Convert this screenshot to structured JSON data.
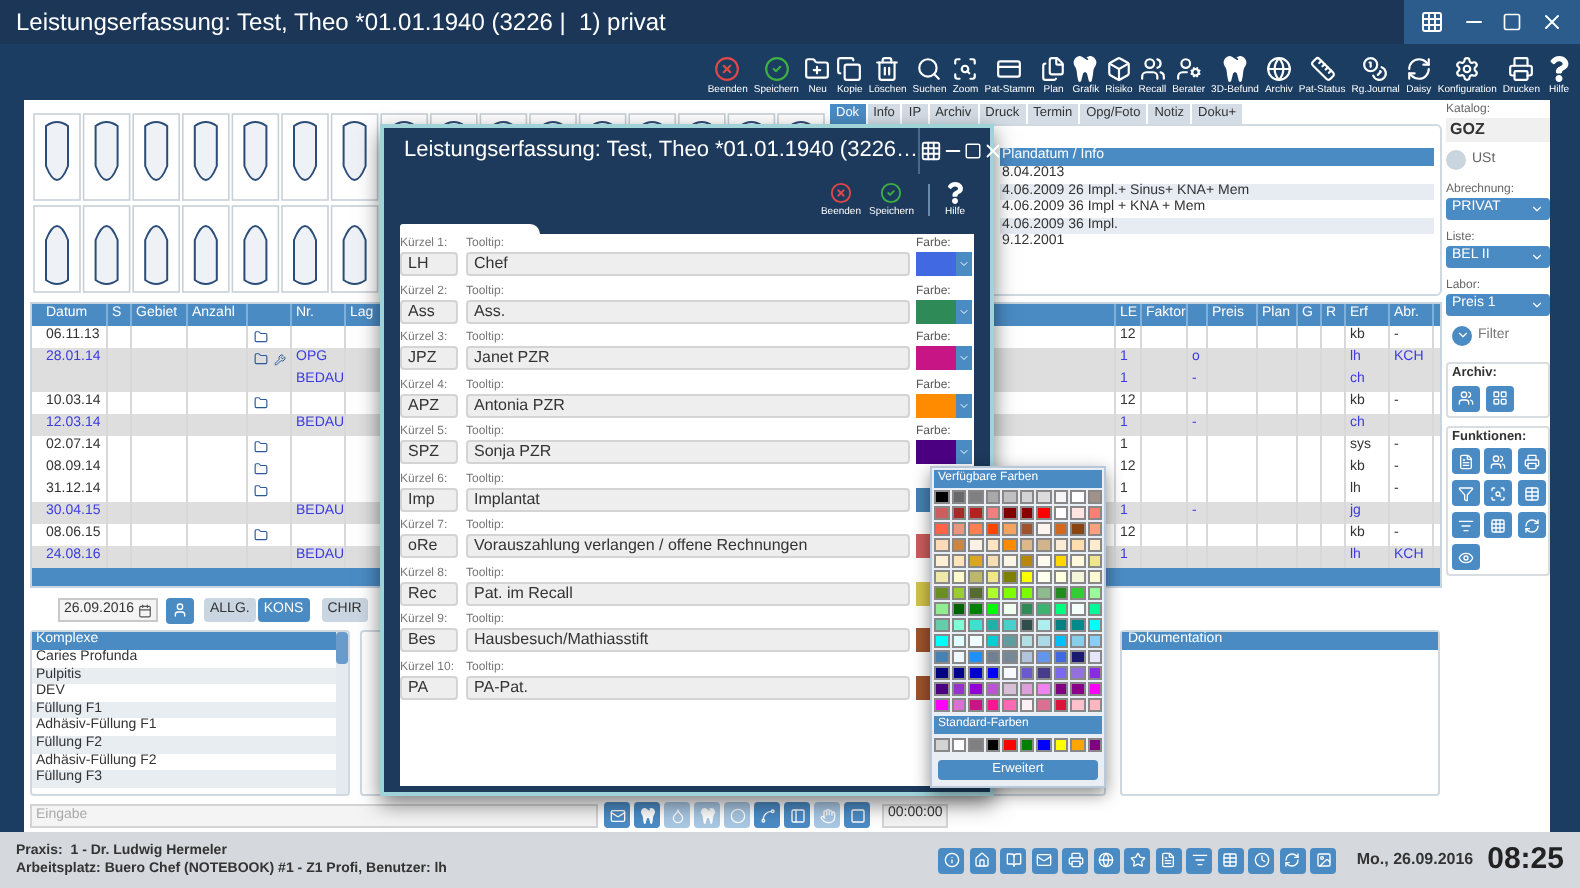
{
  "window": {
    "title": "Leistungserfassung: Test, Theo *01.01.1940 (3226 |  1) privat"
  },
  "toolbar": [
    {
      "label": "Beenden"
    },
    {
      "label": "Speichern"
    },
    {
      "label": "Neu"
    },
    {
      "label": "Kopie"
    },
    {
      "label": "Löschen"
    },
    {
      "label": "Suchen"
    },
    {
      "label": "Zoom"
    },
    {
      "label": "Pat-Stamm"
    },
    {
      "label": "Plan"
    },
    {
      "label": "Grafik"
    },
    {
      "label": "Risiko"
    },
    {
      "label": "Recall"
    },
    {
      "label": "Berater"
    },
    {
      "label": "3D-Befund"
    },
    {
      "label": "Archiv"
    },
    {
      "label": "Pat-Status"
    },
    {
      "label": "Rg.Journal"
    },
    {
      "label": "Daisy"
    },
    {
      "label": "Konfiguration"
    },
    {
      "label": "Drucken"
    },
    {
      "label": "Hilfe"
    }
  ],
  "tabs": [
    {
      "label": "Dok",
      "selected": true
    },
    {
      "label": "Info",
      "selected": false
    },
    {
      "label": "IP",
      "selected": false
    },
    {
      "label": "Archiv",
      "selected": false
    },
    {
      "label": "Druck",
      "selected": false
    },
    {
      "label": "Termin",
      "selected": false
    },
    {
      "label": "Opg/Foto",
      "selected": false
    },
    {
      "label": "Notiz",
      "selected": false
    },
    {
      "label": "Doku+",
      "selected": false
    }
  ],
  "info_panel": {
    "header": "Plandatum / Info",
    "rows": [
      "8.04.2013",
      "4.06.2009 26 Impl.+ Sinus+ KNA+ Mem",
      "4.06.2009 36 Impl + KNA + Mem",
      "4.06.2009 36 Impl.",
      "9.12.2001"
    ]
  },
  "table": {
    "columns": {
      "datum": "Datum",
      "s": "S",
      "gebiet": "Gebiet",
      "anzahl": "Anzahl",
      "nr": "Nr.",
      "lag": "Lag",
      "le": "LE",
      "faktor": "Faktor",
      "preis": "Preis",
      "plan": "Plan",
      "g": "G",
      "r": "R",
      "erf": "Erf",
      "abr": "Abr."
    },
    "rows": [
      {
        "highlighted": false,
        "datum": "06.11.13",
        "folder": true,
        "tool": false,
        "le": "12",
        "erf": "kb",
        "abr": "-"
      },
      {
        "highlighted": true,
        "datum": "28.01.14",
        "folder": true,
        "tool": true,
        "nr": "OPG",
        "le": "1",
        "column_9": "o",
        "erf": "lh",
        "abr": "KCH"
      },
      {
        "highlighted": true,
        "folder": false,
        "tool": false,
        "nr": "BEDAU",
        "le": "1",
        "column_9": "-",
        "erf": "ch"
      },
      {
        "highlighted": false,
        "datum": "10.03.14",
        "folder": true,
        "tool": false,
        "le": "12",
        "erf": "kb",
        "abr": "-"
      },
      {
        "highlighted": true,
        "datum": "12.03.14",
        "folder": false,
        "tool": false,
        "nr": "BEDAU",
        "le": "1",
        "column_9": "-",
        "erf": "ch"
      },
      {
        "highlighted": false,
        "datum": "02.07.14",
        "folder": true,
        "tool": false,
        "le": "1",
        "erf": "sys",
        "abr": "-"
      },
      {
        "highlighted": false,
        "datum": "08.09.14",
        "folder": true,
        "tool": false,
        "le": "12",
        "erf": "kb",
        "abr": "-"
      },
      {
        "highlighted": false,
        "datum": "31.12.14",
        "folder": true,
        "tool": false,
        "le": "1",
        "erf": "lh",
        "abr": "-"
      },
      {
        "highlighted": true,
        "datum": "30.04.15",
        "folder": false,
        "tool": false,
        "nr": "BEDAU",
        "le": "1",
        "column_9": "-",
        "erf": "jg"
      },
      {
        "highlighted": false,
        "datum": "08.06.15",
        "folder": true,
        "tool": false,
        "le": "12",
        "erf": "kb",
        "abr": "-"
      },
      {
        "highlighted": true,
        "datum": "24.08.16",
        "folder": false,
        "tool": false,
        "nr": "BEDAU",
        "le": "1",
        "erf": "lh",
        "abr": "KCH"
      }
    ]
  },
  "sidebar": {
    "katalog_label": "Katalog:",
    "katalog": "GOZ",
    "ust": {
      "label": "USt",
      "checked": false
    },
    "abrechnung": {
      "label": "Abrechnung:",
      "value": "PRIVAT"
    },
    "liste": {
      "label": "Liste:",
      "value": "BEL II"
    },
    "labor": {
      "label": "Labor:",
      "value": "Preis 1"
    },
    "filter": "Filter",
    "archiv_label": "Archiv:",
    "funktionen_label": "Funktionen:"
  },
  "controls": {
    "date": "26.09.2016",
    "categories": [
      {
        "label": "ALLG.",
        "selected": false
      },
      {
        "label": "KONS",
        "selected": true
      },
      {
        "label": "CHIR",
        "selected": false
      }
    ]
  },
  "komplexe": {
    "header": "Komplexe",
    "items": [
      "Caries Profunda",
      "Pulpitis",
      "DEV",
      "Füllung F1",
      "Adhäsiv-Füllung F1",
      "Füllung F2",
      "Adhäsiv-Füllung F2",
      "Füllung F3"
    ]
  },
  "dokumentation": {
    "header": "Dokumentation"
  },
  "input": {
    "placeholder": "Eingabe"
  },
  "bottom_tools": [
    {
      "disabled": false
    },
    {
      "disabled": false
    },
    {
      "disabled": true
    },
    {
      "disabled": true
    },
    {
      "disabled": true
    },
    {
      "disabled": false
    },
    {
      "disabled": false
    },
    {
      "disabled": true
    },
    {
      "disabled": false
    }
  ],
  "timer": "00:00:00",
  "status_bar": {
    "praxis": "Praxis:  1 - Dr. Ludwig Hermeler",
    "arbeitsplatz": "Arbeitsplatz: Buero Chef (NOTEBOOK) #1 - Z1 Profi, Benutzer: lh",
    "date": "Mo., 26.09.2016",
    "time": "08:25"
  },
  "dialog": {
    "title": "Leistungserfassung: Test, Theo *01.01.1940 (3226…",
    "toolbar": [
      {
        "label": "Beenden"
      },
      {
        "label": "Speichern"
      },
      {
        "label": "Hilfe"
      }
    ],
    "rows": [
      {
        "kuerzel_label": "Kürzel 1:",
        "kuerzel": "LH",
        "tooltip_label": "Tooltip:",
        "tooltip": "Chef",
        "color_label": "Farbe:",
        "color": "#4169e1"
      },
      {
        "kuerzel_label": "Kürzel 2:",
        "kuerzel": "Ass",
        "tooltip_label": "Tooltip:",
        "tooltip": "Ass.",
        "color_label": "Farbe:",
        "color": "#2e8b57"
      },
      {
        "kuerzel_label": "Kürzel 3:",
        "kuerzel": "JPZ",
        "tooltip_label": "Tooltip:",
        "tooltip": "Janet PZR",
        "color_label": "Farbe:",
        "color": "#c71585"
      },
      {
        "kuerzel_label": "Kürzel 4:",
        "kuerzel": "APZ",
        "tooltip_label": "Tooltip:",
        "tooltip": "Antonia PZR",
        "color_label": "Farbe:",
        "color": "#ff8c00"
      },
      {
        "kuerzel_label": "Kürzel 5:",
        "kuerzel": "SPZ",
        "tooltip_label": "Tooltip:",
        "tooltip": "Sonja PZR",
        "color_label": "Farbe:",
        "color": "#4b0082"
      },
      {
        "kuerzel_label": "Kürzel 6:",
        "kuerzel": "Imp",
        "tooltip_label": "Tooltip:",
        "tooltip": "Implantat",
        "color": "#4682b4"
      },
      {
        "kuerzel_label": "Kürzel 7:",
        "kuerzel": "oRe",
        "tooltip_label": "Tooltip:",
        "tooltip": "Vorauszahlung verlangen / offene Rechnungen",
        "color": "#cd5c5c"
      },
      {
        "kuerzel_label": "Kürzel 8:",
        "kuerzel": "Rec",
        "tooltip_label": "Tooltip:",
        "tooltip": "Pat. im Recall",
        "color": "#d4c44a"
      },
      {
        "kuerzel_label": "Kürzel 9:",
        "kuerzel": "Bes",
        "tooltip_label": "Tooltip:",
        "tooltip": "Hausbesuch/Mathiasstift",
        "color": "#a0522d"
      },
      {
        "kuerzel_label": "Kürzel 10:",
        "kuerzel": "PA",
        "tooltip_label": "Tooltip:",
        "tooltip": "PA-Pat.",
        "color": "#a0522d"
      }
    ]
  },
  "color_popup": {
    "title": "Verfügbare Farben",
    "rows": [
      {
        "swatches": [
          {
            "color": "#000000"
          },
          {
            "color": "#696969"
          },
          {
            "color": "#808080"
          },
          {
            "color": "#a9a9a9"
          },
          {
            "color": "#c0c0c0"
          },
          {
            "color": "#d3d3d3"
          },
          {
            "color": "#dcdcdc"
          },
          {
            "color": "#f5f5f5"
          },
          {
            "color": "#ffffff"
          },
          {
            "color": "#a0928a"
          }
        ]
      },
      {
        "swatches": [
          {
            "color": "#cd5c5c"
          },
          {
            "color": "#a52a2a"
          },
          {
            "color": "#b22222"
          },
          {
            "color": "#f08080"
          },
          {
            "color": "#800000"
          },
          {
            "color": "#8b0000"
          },
          {
            "color": "#ff0000"
          },
          {
            "color": "#ffffff"
          },
          {
            "color": "#ffe4e1"
          },
          {
            "color": "#fa8072"
          }
        ]
      },
      {
        "swatches": [
          {
            "color": "#ff6347"
          },
          {
            "color": "#e9967a"
          },
          {
            "color": "#ff7f50"
          },
          {
            "color": "#ff4500"
          },
          {
            "color": "#f4a460"
          },
          {
            "color": "#a0522d"
          },
          {
            "color": "#fff5ee"
          },
          {
            "color": "#d2691e"
          },
          {
            "color": "#8b4513"
          },
          {
            "color": "#ffa07a"
          }
        ]
      },
      {
        "swatches": [
          {
            "color": "#ffdab9"
          },
          {
            "color": "#cd853f"
          },
          {
            "color": "#faf0e6"
          },
          {
            "color": "#ffe4c4"
          },
          {
            "color": "#ff8c00"
          },
          {
            "color": "#deb887"
          },
          {
            "color": "#d2b48c"
          },
          {
            "color": "#faebd7"
          },
          {
            "color": "#ffdead"
          },
          {
            "color": "#ffebcd"
          }
        ]
      },
      {
        "swatches": [
          {
            "color": "#ffefd5"
          },
          {
            "color": "#ffe4b5"
          },
          {
            "color": "#daa520"
          },
          {
            "color": "#f5deb3"
          },
          {
            "color": "#fdf5e6"
          },
          {
            "color": "#b8860b"
          },
          {
            "color": "#fffaf0"
          },
          {
            "color": "#ffd700"
          },
          {
            "color": "#fff8dc"
          },
          {
            "color": "#f0e68c"
          }
        ]
      },
      {
        "swatches": [
          {
            "color": "#eee8aa"
          },
          {
            "color": "#fffacd"
          },
          {
            "color": "#bdb76b"
          },
          {
            "color": "#f0e68c"
          },
          {
            "color": "#808000"
          },
          {
            "color": "#ffff00"
          },
          {
            "color": "#fffff0"
          },
          {
            "color": "#ffffe0"
          },
          {
            "color": "#f5f5dc"
          },
          {
            "color": "#fafad2"
          }
        ]
      },
      {
        "swatches": [
          {
            "color": "#6b8e23"
          },
          {
            "color": "#9acd32"
          },
          {
            "color": "#556b2f"
          },
          {
            "color": "#adff2f"
          },
          {
            "color": "#7fff00"
          },
          {
            "color": "#7cfc00"
          },
          {
            "color": "#8fbc8f"
          },
          {
            "color": "#228b22"
          },
          {
            "color": "#32cd32"
          },
          {
            "color": "#98fb98"
          }
        ]
      },
      {
        "swatches": [
          {
            "color": "#90ee90"
          },
          {
            "color": "#006400"
          },
          {
            "color": "#008000"
          },
          {
            "color": "#00ff00"
          },
          {
            "color": "#f0fff0"
          },
          {
            "color": "#2e8b57"
          },
          {
            "color": "#3cb371"
          },
          {
            "color": "#00ff7f"
          },
          {
            "color": "#f5fffa"
          },
          {
            "color": "#00fa9a"
          }
        ]
      },
      {
        "swatches": [
          {
            "color": "#66cdaa"
          },
          {
            "color": "#7fffd4"
          },
          {
            "color": "#40e0d0"
          },
          {
            "color": "#20b2aa"
          },
          {
            "color": "#48d1cc"
          },
          {
            "color": "#2f4f4f"
          },
          {
            "color": "#afeeee"
          },
          {
            "color": "#008080"
          },
          {
            "color": "#008b8b"
          },
          {
            "color": "#00ffff"
          }
        ]
      },
      {
        "swatches": [
          {
            "color": "#00ffff"
          },
          {
            "color": "#e0ffff"
          },
          {
            "color": "#f0ffff"
          },
          {
            "color": "#00ced1"
          },
          {
            "color": "#5f9ea0"
          },
          {
            "color": "#b0e0e6"
          },
          {
            "color": "#add8e6"
          },
          {
            "color": "#00bfff"
          },
          {
            "color": "#87ceeb"
          },
          {
            "color": "#87cefa"
          }
        ]
      },
      {
        "swatches": [
          {
            "color": "#4682b4"
          },
          {
            "color": "#f0f8ff"
          },
          {
            "color": "#1e90ff"
          },
          {
            "color": "#708090"
          },
          {
            "color": "#778899"
          },
          {
            "color": "#b0c4de"
          },
          {
            "color": "#6495ed"
          },
          {
            "color": "#4169e1"
          },
          {
            "color": "#191970"
          },
          {
            "color": "#e6e6fa"
          }
        ]
      },
      {
        "swatches": [
          {
            "color": "#000080"
          },
          {
            "color": "#00008b"
          },
          {
            "color": "#0000cd"
          },
          {
            "color": "#0000ff"
          },
          {
            "color": "#f8f8ff"
          },
          {
            "color": "#6a5acd"
          },
          {
            "color": "#483d8b"
          },
          {
            "color": "#7b68ee"
          },
          {
            "color": "#9370db"
          },
          {
            "color": "#8a2be2"
          }
        ]
      },
      {
        "swatches": [
          {
            "color": "#4b0082"
          },
          {
            "color": "#9932cc"
          },
          {
            "color": "#9400d3"
          },
          {
            "color": "#ba55d3"
          },
          {
            "color": "#d8bfd8"
          },
          {
            "color": "#dda0dd"
          },
          {
            "color": "#ee82ee"
          },
          {
            "color": "#800080"
          },
          {
            "color": "#8b008b"
          },
          {
            "color": "#ff00ff"
          }
        ]
      },
      {
        "swatches": [
          {
            "color": "#ff00ff"
          },
          {
            "color": "#da70d6"
          },
          {
            "color": "#c71585"
          },
          {
            "color": "#ff1493"
          },
          {
            "color": "#ff69b4"
          },
          {
            "color": "#fff0f5"
          },
          {
            "color": "#db7093"
          },
          {
            "color": "#dc143c"
          },
          {
            "color": "#ffc0cb"
          },
          {
            "color": "#ffb6c1"
          }
        ]
      }
    ],
    "standard_title": "Standard-Farben",
    "standard": [
      {
        "color": "#d3d3d3"
      },
      {
        "color": "#ffffff"
      },
      {
        "color": "#808080"
      },
      {
        "color": "#000000"
      },
      {
        "color": "#ff0000"
      },
      {
        "color": "#008000"
      },
      {
        "color": "#0000ff"
      },
      {
        "color": "#ffff00"
      },
      {
        "color": "#ffa500"
      },
      {
        "color": "#800080"
      }
    ],
    "button": "Erweitert"
  }
}
